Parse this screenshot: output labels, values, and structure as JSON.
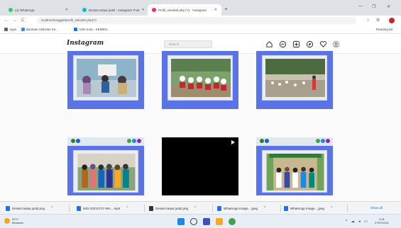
{
  "browser": {
    "tabs": [
      {
        "label": "(4) WhatsApp",
        "color": "#25d366"
      },
      {
        "label": "Desain tanpa judul - Instagram Post",
        "color": "#00c4cc"
      },
      {
        "label": "Profil_sekolah.php (Y) - Instagram",
        "color": "#e1306c"
      }
    ],
    "new_tab": "+",
    "url": "localhost/unggah/profil_sekolah.php(Y)",
    "bookmarks": [
      {
        "label": "Apps",
        "color": "#5f6368"
      },
      {
        "label": "Bantuan Aktivitas Ke...",
        "color": "#4285f4"
      },
      {
        "label": "ASN Kota - KEMEN...",
        "color": "#1a73e8"
      }
    ],
    "reading_list": "Reading list"
  },
  "instagram": {
    "logo": "Instagram",
    "search_placeholder": "Search",
    "icons": [
      "home-icon",
      "messenger-icon",
      "new-post-icon",
      "explore-icon",
      "heart-icon",
      "profile-avatar"
    ]
  },
  "downloads": {
    "items": [
      {
        "label": "Desain tanpa judul.png",
        "color": "#1a73e8"
      },
      {
        "label": "IMG-20210727-WA....mp4",
        "color": "#1a73e8"
      },
      {
        "label": "Desain tanpa judul.png",
        "color": "#333333"
      },
      {
        "label": "WhatsApp Image....jpeg",
        "color": "#1a73e8"
      },
      {
        "label": "WhatsApp Image....jpeg",
        "color": "#1a73e8"
      }
    ],
    "show_all": "Show all"
  },
  "taskbar": {
    "weather_temp": "29°C",
    "weather_desc": "Berawan",
    "time": "9:41",
    "date": "27/07/2021"
  },
  "colors": {
    "post_frame": "#5a73e6",
    "accent": "#1a73e8"
  }
}
